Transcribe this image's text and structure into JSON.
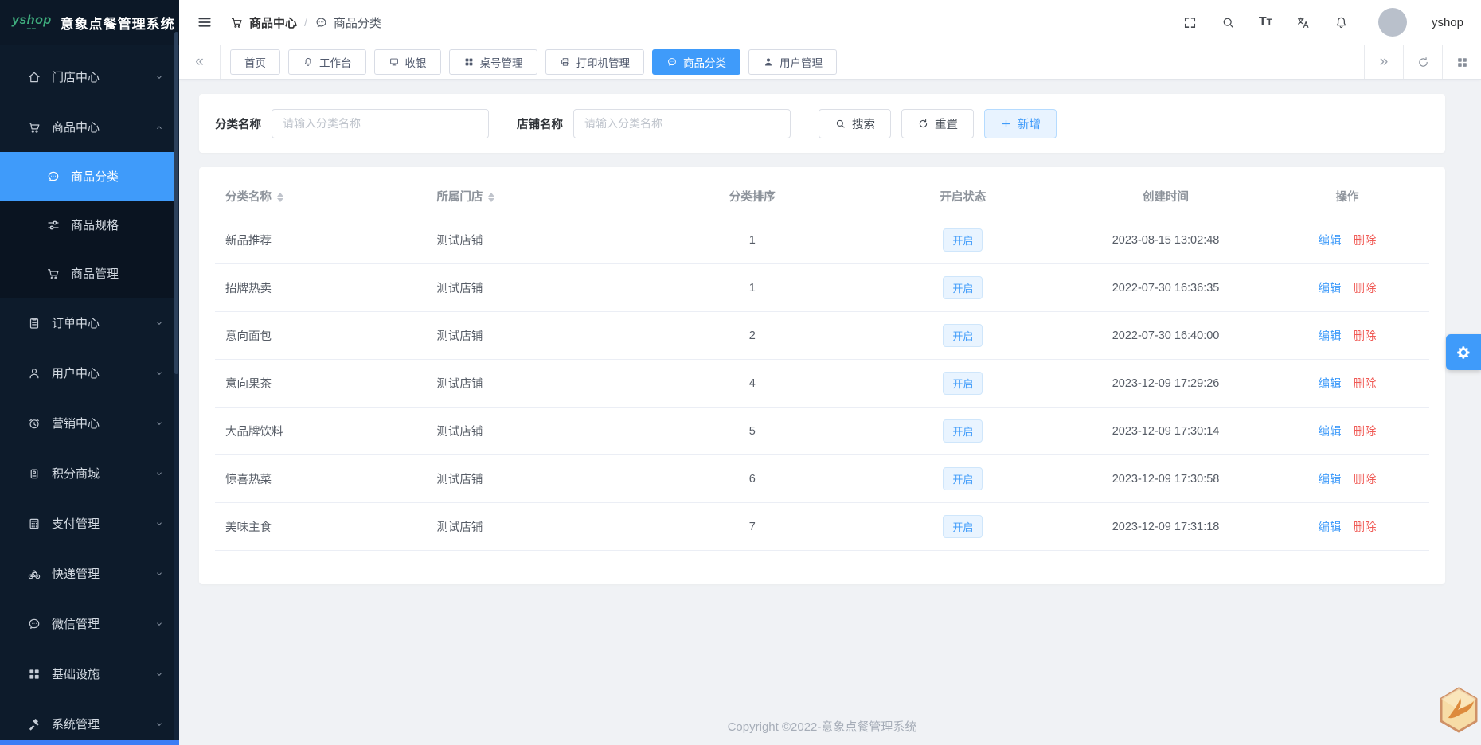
{
  "app": {
    "logo_text": "yshop",
    "title": "意象点餐管理系统"
  },
  "sidebar": {
    "items": [
      {
        "label": "门店中心",
        "icon": "home-icon",
        "chevron": "down"
      },
      {
        "label": "商品中心",
        "icon": "cart-icon",
        "chevron": "up",
        "expanded": true,
        "children": [
          {
            "label": "商品分类",
            "icon": "chat-icon",
            "active": true
          },
          {
            "label": "商品规格",
            "icon": "sliders-icon",
            "active": false
          },
          {
            "label": "商品管理",
            "icon": "cart-icon",
            "active": false
          }
        ]
      },
      {
        "label": "订单中心",
        "icon": "clipboard-icon",
        "chevron": "down"
      },
      {
        "label": "用户中心",
        "icon": "user-icon",
        "chevron": "down"
      },
      {
        "label": "营销中心",
        "icon": "alarm-icon",
        "chevron": "down"
      },
      {
        "label": "积分商城",
        "icon": "badge-icon",
        "chevron": "down"
      },
      {
        "label": "支付管理",
        "icon": "calculator-icon",
        "chevron": "down"
      },
      {
        "label": "快递管理",
        "icon": "bike-icon",
        "chevron": "down"
      },
      {
        "label": "微信管理",
        "icon": "chat-icon",
        "chevron": "down"
      },
      {
        "label": "基础设施",
        "icon": "grid-icon",
        "chevron": "down"
      },
      {
        "label": "系统管理",
        "icon": "hammer-icon",
        "chevron": "down"
      }
    ]
  },
  "header": {
    "separator": "/",
    "breadcrumb": [
      {
        "label": "商品中心",
        "icon": "cart-icon"
      },
      {
        "label": "商品分类",
        "icon": "chat-icon"
      }
    ],
    "username": "yshop"
  },
  "tabbar": {
    "tabs": [
      {
        "label": "首页",
        "icon": null,
        "active": false
      },
      {
        "label": "工作台",
        "icon": "bell-icon",
        "active": false
      },
      {
        "label": "收银",
        "icon": "monitor-icon",
        "active": false
      },
      {
        "label": "桌号管理",
        "icon": "grid-icon",
        "active": false
      },
      {
        "label": "打印机管理",
        "icon": "printer-icon",
        "active": false
      },
      {
        "label": "商品分类",
        "icon": "chat-icon",
        "active": true
      },
      {
        "label": "用户管理",
        "icon": "user-solid-icon",
        "active": false
      }
    ]
  },
  "filters": {
    "category_label": "分类名称",
    "category_placeholder": "请输入分类名称",
    "shop_label": "店铺名称",
    "shop_placeholder": "请输入分类名称",
    "search_label": "搜索",
    "reset_label": "重置",
    "add_label": "新增"
  },
  "table": {
    "columns": [
      {
        "label": "分类名称",
        "sortable": true,
        "align": "left",
        "width": "17.4%"
      },
      {
        "label": "所属门店",
        "sortable": true,
        "align": "left",
        "width": "18%"
      },
      {
        "label": "分类排序",
        "sortable": false,
        "align": "center",
        "width": "17.7%"
      },
      {
        "label": "开启状态",
        "sortable": false,
        "align": "center",
        "width": "17%"
      },
      {
        "label": "创建时间",
        "sortable": false,
        "align": "center",
        "width": "16.4%"
      },
      {
        "label": "操作",
        "sortable": false,
        "align": "center",
        "width": "13.5%"
      }
    ],
    "edit_label": "编辑",
    "delete_label": "删除",
    "rows": [
      {
        "name": "新品推荐",
        "shop": "测试店铺",
        "sort": "1",
        "status": "开启",
        "created": "2023-08-15 13:02:48"
      },
      {
        "name": "招牌热卖",
        "shop": "测试店铺",
        "sort": "1",
        "status": "开启",
        "created": "2022-07-30 16:36:35"
      },
      {
        "name": "意向面包",
        "shop": "测试店铺",
        "sort": "2",
        "status": "开启",
        "created": "2022-07-30 16:40:00"
      },
      {
        "name": "意向果茶",
        "shop": "测试店铺",
        "sort": "4",
        "status": "开启",
        "created": "2023-12-09 17:29:26"
      },
      {
        "name": "大品牌饮料",
        "shop": "测试店铺",
        "sort": "5",
        "status": "开启",
        "created": "2023-12-09 17:30:14"
      },
      {
        "name": "惊喜热菜",
        "shop": "测试店铺",
        "sort": "6",
        "status": "开启",
        "created": "2023-12-09 17:30:58"
      },
      {
        "name": "美味主食",
        "shop": "测试店铺",
        "sort": "7",
        "status": "开启",
        "created": "2023-12-09 17:31:18"
      }
    ]
  },
  "footer": {
    "copyright": "Copyright ©2022-意象点餐管理系统"
  },
  "colors": {
    "primary": "#3f9bfa",
    "danger": "#f05b56",
    "sidebar_bg": "#0d1b2b",
    "status_bg": "#e9f4ff"
  }
}
